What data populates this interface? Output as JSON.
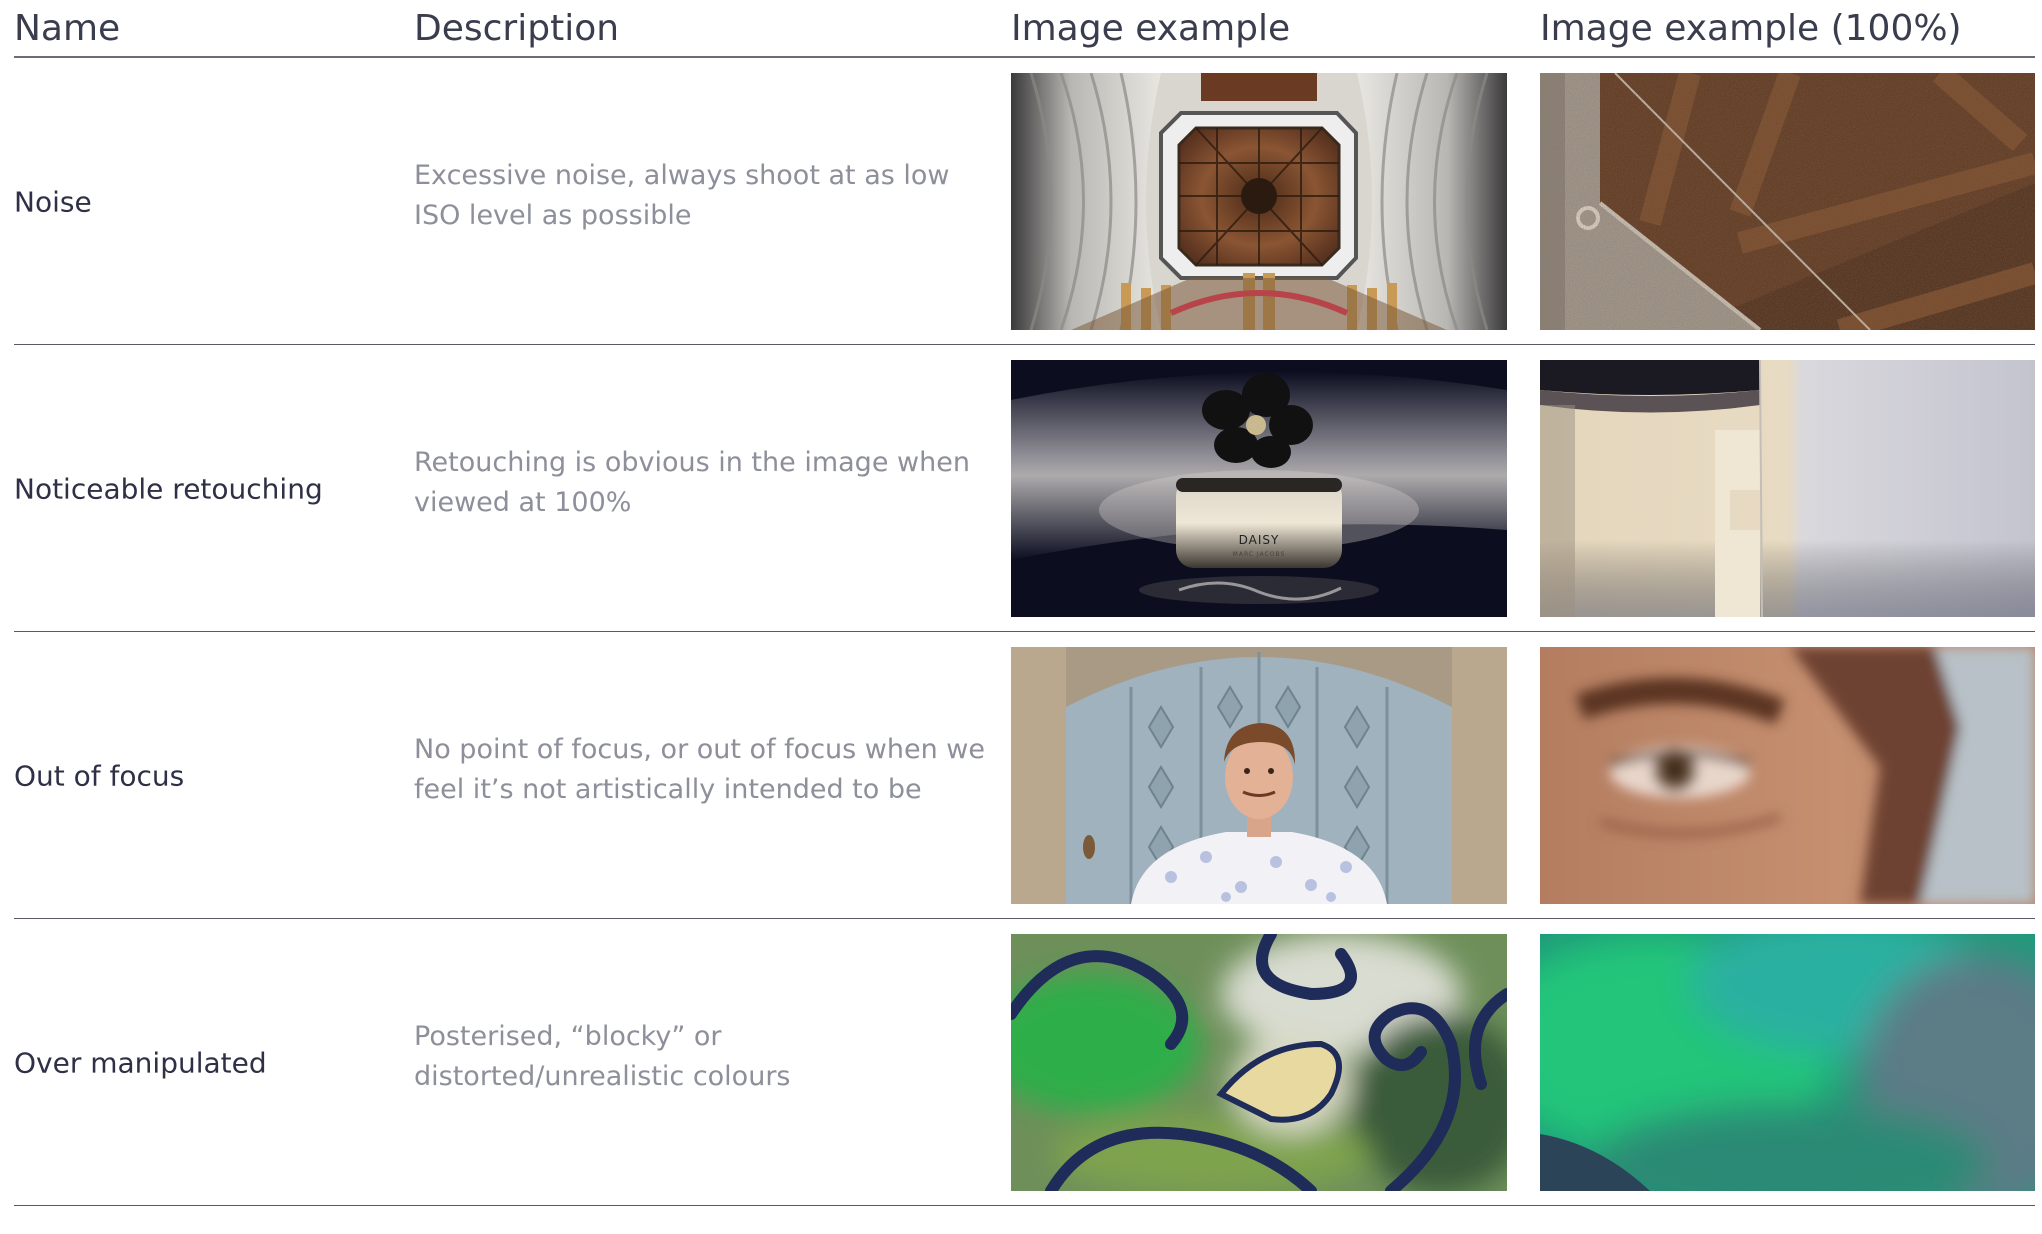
{
  "header": {
    "name": "Name",
    "description": "Description",
    "image_example": "Image example",
    "image_example_100": "Image example (100%)"
  },
  "rows": [
    {
      "name": "Noise",
      "description": "Excessive noise, always shoot at as low ISO level as possible",
      "example_image": "cathedral-ceiling-photo",
      "zoom_image": "noisy-ceiling-crop"
    },
    {
      "name": "Noticeable retouching",
      "description": "Retouching is obvious in the image when viewed at 100%",
      "example_image": "perfume-bottle-photo",
      "zoom_image": "retouched-bottle-crop",
      "bottle_label": "DAISY",
      "bottle_sublabel": "MARC JACOBS"
    },
    {
      "name": "Out of focus",
      "description": "No point of focus, or out of focus when we feel it’s not artistically intended to be",
      "example_image": "portrait-door-photo",
      "zoom_image": "blurry-eye-crop"
    },
    {
      "name": "Over manipulated",
      "description": "Posterised, “blocky” or distorted/unrealistic colours",
      "example_image": "wrought-iron-gate-photo",
      "zoom_image": "posterised-background-crop"
    }
  ]
}
